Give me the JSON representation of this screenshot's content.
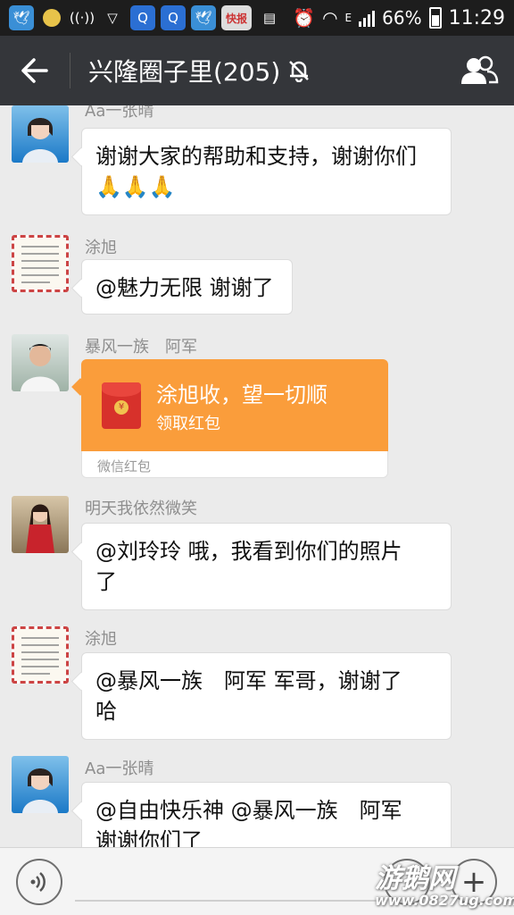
{
  "status_bar": {
    "battery_percent": "66%",
    "time": "11:29",
    "network_type": "E",
    "icons": [
      "bird-app-icon",
      "dot-icon",
      "radio-icon",
      "shield-icon",
      "search-icon",
      "search-icon",
      "bird-app-icon",
      "news-icon",
      "message-icon",
      "alarm-icon",
      "wifi-icon",
      "signal-icon",
      "battery-icon"
    ]
  },
  "header": {
    "title": "兴隆圈子里(205)",
    "muted_icon": "bell-mute-icon",
    "back_icon": "back-arrow-icon",
    "members_icon": "group-members-icon",
    "bg_color": "#34363a"
  },
  "messages": [
    {
      "sender": "Aa一张晴",
      "text_lines": [
        "谢谢大家的帮助和支持，谢谢你们",
        "🙏🙏🙏"
      ],
      "avatar": "woman-avatar-blue"
    },
    {
      "sender": "涂旭",
      "text_lines": [
        "@魅力无限 谢谢了"
      ],
      "avatar": "letter-avatar"
    },
    {
      "sender": "暴风一族　阿军",
      "red_packet": {
        "title": "涂旭收，望一切顺",
        "subtitle": "领取红包",
        "footer": "微信红包",
        "color": "#fa9d3b"
      },
      "avatar": "man-avatar"
    },
    {
      "sender": "明天我依然微笑",
      "text_lines": [
        "@刘玲玲 哦，我看到你们的照片",
        "了"
      ],
      "avatar": "woman-avatar-red"
    },
    {
      "sender": "涂旭",
      "text_lines": [
        "@暴风一族　阿军 军哥，谢谢了",
        "哈"
      ],
      "avatar": "letter-avatar"
    },
    {
      "sender": "Aa一张晴",
      "text_lines": [
        "@自由快乐神 @暴风一族　阿军",
        "谢谢你们了"
      ],
      "avatar": "woman-avatar-blue"
    }
  ],
  "input_bar": {
    "voice_icon": "voice-icon",
    "emoji_icon": "emoji-icon",
    "plus_icon": "plus-icon"
  },
  "watermark": {
    "text": "游鹅网",
    "url": "www.0827ug.com"
  }
}
